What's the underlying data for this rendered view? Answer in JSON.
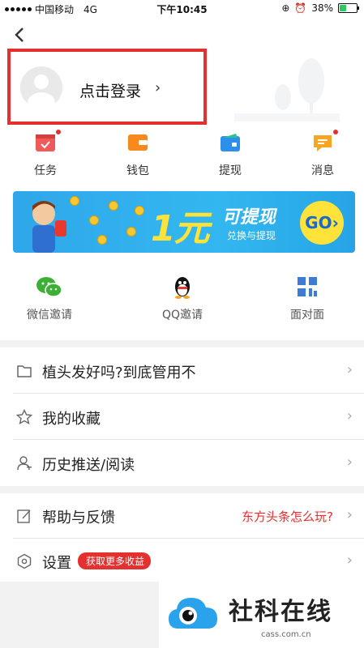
{
  "status_bar": {
    "carrier": "中国移动",
    "network": "4G",
    "time": "下午10:45",
    "battery_pct": "38%",
    "battery_level": 0.38
  },
  "header": {
    "login_label": "点击登录",
    "login_arrow": "›"
  },
  "quick_actions": [
    {
      "label": "任务",
      "icon": "task-icon",
      "color": "#f05a5a",
      "has_dot": true
    },
    {
      "label": "钱包",
      "icon": "wallet-icon",
      "color": "#f7891f",
      "has_dot": false
    },
    {
      "label": "提现",
      "icon": "withdraw-icon",
      "color": "#2e8fea",
      "has_dot": false
    },
    {
      "label": "消息",
      "icon": "message-icon",
      "color": "#f6a623",
      "has_dot": true
    }
  ],
  "banner": {
    "amount": "1元",
    "title": "可提现",
    "subtitle": "兑换与提现",
    "go_label": "GO›"
  },
  "invite": [
    {
      "label": "微信邀请",
      "icon": "wechat-icon"
    },
    {
      "label": "QQ邀请",
      "icon": "qq-icon"
    },
    {
      "label": "面对面",
      "icon": "qrcode-icon"
    }
  ],
  "list": {
    "group1": [
      {
        "label": "植头发好吗?到底管用不",
        "icon": "folder-icon"
      },
      {
        "label": "我的收藏",
        "icon": "star-icon"
      },
      {
        "label": "历史推送/阅读",
        "icon": "person-history-icon"
      }
    ],
    "help": {
      "label": "帮助与反馈",
      "icon": "edit-icon",
      "right_text": "东方头条怎么玩?"
    },
    "settings": {
      "label": "设置",
      "icon": "settings-hex-icon",
      "badge": "获取更多收益"
    }
  },
  "watermark": {
    "text": "社科在线",
    "domain": "cass.com.cn"
  },
  "colors": {
    "accent_red": "#e53030",
    "banner_blue": "#2fa7ea",
    "banner_yellow": "#ffe23a"
  }
}
